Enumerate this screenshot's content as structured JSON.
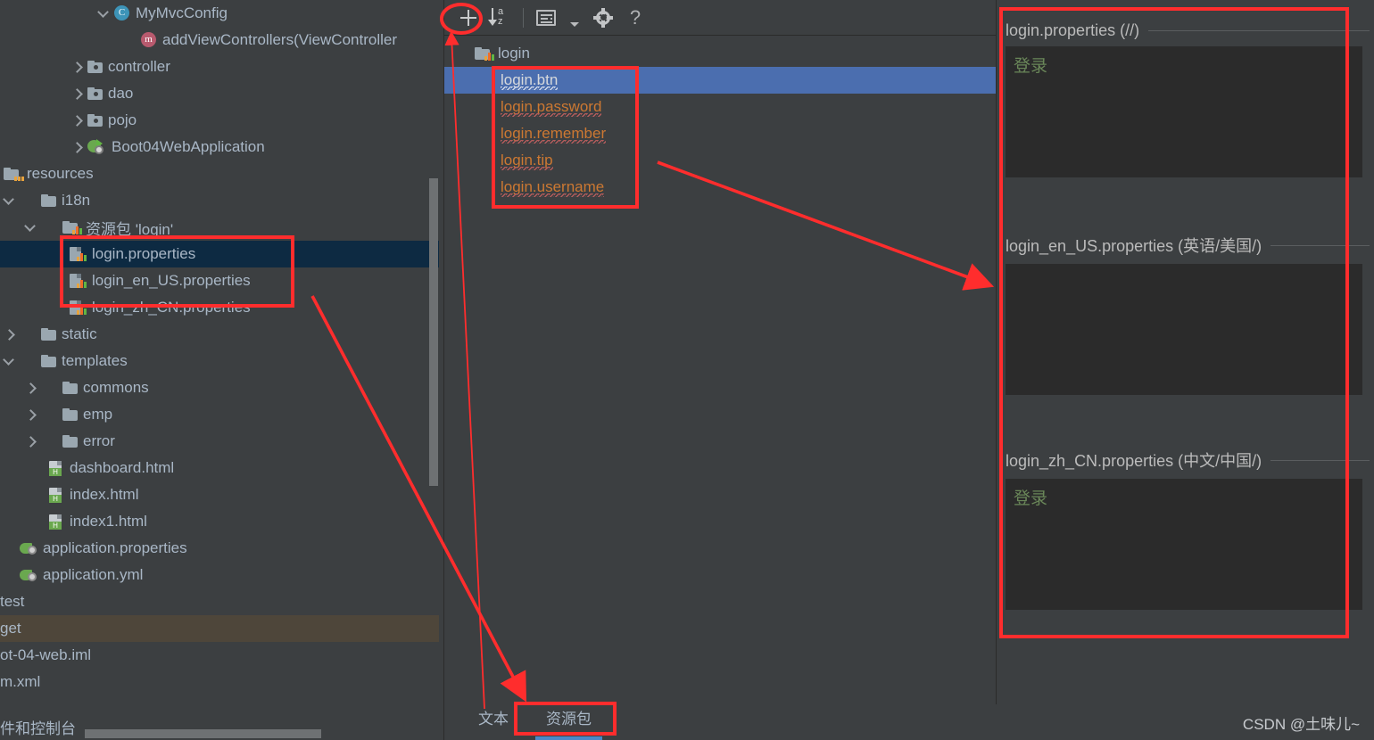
{
  "project_tree": {
    "name": "project-tree",
    "items": [
      {
        "label": "MyMvcConfig",
        "icon": "class-icon",
        "indent": 108,
        "chevron": "down",
        "type": "class"
      },
      {
        "label": "addViewControllers(ViewController",
        "icon": "method-icon",
        "indent": 158,
        "chevron": "none",
        "type": "method"
      },
      {
        "label": "controller",
        "icon": "package-folder-icon",
        "indent": 78,
        "chevron": "right",
        "type": "package"
      },
      {
        "label": "dao",
        "icon": "package-folder-icon",
        "indent": 78,
        "chevron": "right",
        "type": "package"
      },
      {
        "label": "pojo",
        "icon": "package-folder-icon",
        "indent": 78,
        "chevron": "right",
        "type": "package"
      },
      {
        "label": "Boot04WebApplication",
        "icon": "spring-boot-icon",
        "indent": 78,
        "chevron": "right",
        "type": "springboot"
      },
      {
        "label": "resources",
        "icon": "resource-root-icon",
        "indent": 0,
        "chevron": "none",
        "type": "resroot"
      },
      {
        "label": "i18n",
        "icon": "folder-icon",
        "indent": 0,
        "chevron": "down",
        "type": "folder"
      },
      {
        "label": "资源包 'login'",
        "icon": "resource-bundle-icon",
        "indent": 28,
        "chevron": "down",
        "type": "bundle"
      },
      {
        "label": "login.properties",
        "icon": "properties-icon",
        "indent": 78,
        "chevron": "none",
        "type": "properties",
        "selected": true
      },
      {
        "label": "login_en_US.properties",
        "icon": "properties-icon",
        "indent": 78,
        "chevron": "none",
        "type": "properties"
      },
      {
        "label": "login_zh_CN.properties",
        "icon": "properties-icon",
        "indent": 78,
        "chevron": "none",
        "type": "properties"
      },
      {
        "label": "static",
        "icon": "folder-icon",
        "indent": 0,
        "chevron": "right",
        "type": "folder"
      },
      {
        "label": "templates",
        "icon": "folder-icon",
        "indent": 0,
        "chevron": "down",
        "type": "folder"
      },
      {
        "label": "commons",
        "icon": "folder-icon",
        "indent": 28,
        "chevron": "right",
        "type": "folder"
      },
      {
        "label": "emp",
        "icon": "folder-icon",
        "indent": 28,
        "chevron": "right",
        "type": "folder"
      },
      {
        "label": "error",
        "icon": "folder-icon",
        "indent": 28,
        "chevron": "right",
        "type": "folder"
      },
      {
        "label": "dashboard.html",
        "icon": "html-icon",
        "indent": 52,
        "chevron": "none",
        "type": "html"
      },
      {
        "label": "index.html",
        "icon": "html-icon",
        "indent": 52,
        "chevron": "none",
        "type": "html"
      },
      {
        "label": "index1.html",
        "icon": "html-icon",
        "indent": 52,
        "chevron": "none",
        "type": "html"
      },
      {
        "label": "application.properties",
        "icon": "spring-config-icon",
        "indent": 22,
        "chevron": "none",
        "type": "spring"
      },
      {
        "label": "application.yml",
        "icon": "spring-config-icon",
        "indent": 22,
        "chevron": "none",
        "type": "spring"
      },
      {
        "label": "test",
        "icon": "none",
        "indent": 0,
        "chevron": "none",
        "type": "plain"
      },
      {
        "label": "get",
        "icon": "none",
        "indent": 0,
        "chevron": "none",
        "type": "plain",
        "dim_highlight": true
      },
      {
        "label": "ot-04-web.iml",
        "icon": "none",
        "indent": 0,
        "chevron": "none",
        "type": "plain"
      },
      {
        "label": "m.xml",
        "icon": "none",
        "indent": 0,
        "chevron": "none",
        "type": "plain"
      }
    ],
    "status_text": "件和控制台"
  },
  "keys_pane": {
    "toolbar": {
      "add_label": "+",
      "sort_label": "a\nz",
      "list_label": "list-icon",
      "dropdown_label": "▾",
      "settings_label": "gear",
      "help_label": "?"
    },
    "root": {
      "label": "login",
      "icon": "resource-bundle-icon"
    },
    "keys": [
      {
        "label": "login.btn",
        "selected": true
      },
      {
        "label": "login.password",
        "selected": false
      },
      {
        "label": "login.remember",
        "selected": false
      },
      {
        "label": "login.tip",
        "selected": false
      },
      {
        "label": "login.username",
        "selected": false
      }
    ]
  },
  "bottom_tabs": {
    "tabs": [
      {
        "label": "文本",
        "active": false
      },
      {
        "label": "资源包",
        "active": true
      }
    ]
  },
  "values_pane": {
    "sections": [
      {
        "title": "login.properties (//)",
        "value": "登录"
      },
      {
        "title": "login_en_US.properties (英语/美国/)",
        "value": ""
      },
      {
        "title": "login_zh_CN.properties (中文/中国/)",
        "value": "登录"
      }
    ]
  },
  "watermark": {
    "text": "CSDN @土味儿~"
  },
  "colors": {
    "background": "#3c3f41",
    "editor_background": "#2b2b2b",
    "selection_blue": "#4b6eaf",
    "tree_selection": "#0d2a42",
    "annotation_red": "#ff2d2d",
    "key_orange": "#cc7832",
    "value_green": "#6a8759",
    "accent_blue": "#4a88c7",
    "text": "#a9b7c6"
  }
}
